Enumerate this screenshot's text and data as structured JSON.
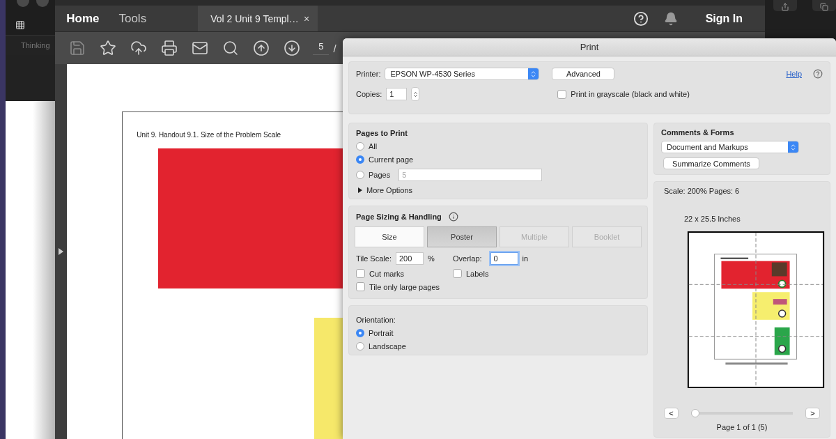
{
  "side_app": {
    "label": "Thinking"
  },
  "nav": [
    {
      "label": "Home",
      "selected": true
    },
    {
      "label": "Tools",
      "selected": false
    }
  ],
  "document_tab": {
    "label": "Vol 2 Unit 9 Templ…",
    "close": "×"
  },
  "sign_in": "Sign In",
  "toolbar": {
    "page": "5",
    "separator": "/"
  },
  "document": {
    "heading": "Unit 9. Handout 9.1. Size of the Problem Scale"
  },
  "print": {
    "title": "Print",
    "printer_label": "Printer:",
    "printer": "EPSON WP-4530 Series",
    "advanced": "Advanced",
    "help": "Help",
    "copies_label": "Copies:",
    "copies": "1",
    "grayscale": {
      "label": "Print in grayscale (black and white)",
      "checked": false
    },
    "pages_to_print": {
      "title": "Pages to Print",
      "options": [
        {
          "label": "All",
          "selected": false
        },
        {
          "label": "Current page",
          "selected": true
        },
        {
          "label": "Pages",
          "selected": false
        }
      ],
      "pages_placeholder": "5",
      "more_options": {
        "label": "More Options",
        "expanded": false
      }
    },
    "sizing": {
      "title": "Page Sizing & Handling",
      "modes": [
        {
          "label": "Size",
          "selected": false,
          "disabled": false
        },
        {
          "label": "Poster",
          "selected": true,
          "disabled": false
        },
        {
          "label": "Multiple",
          "selected": false,
          "disabled": true
        },
        {
          "label": "Booklet",
          "selected": false,
          "disabled": true
        }
      ],
      "tile_scale_label": "Tile Scale:",
      "tile_scale": "200",
      "percent": "%",
      "overlap_label": "Overlap:",
      "overlap": "0",
      "unit": "in",
      "options": [
        {
          "label": "Cut marks",
          "checked": false
        },
        {
          "label": "Labels",
          "checked": false
        },
        {
          "label": "Tile only large pages",
          "checked": false
        }
      ]
    },
    "orientation": {
      "title": "Orientation:",
      "options": [
        {
          "label": "Portrait",
          "selected": true
        },
        {
          "label": "Landscape",
          "selected": false
        }
      ]
    },
    "comments": {
      "title": "Comments & Forms",
      "select": "Document and Markups",
      "summarize": "Summarize Comments"
    },
    "preview": {
      "scale": "Scale: 200% Pages: 6",
      "size": "22 x 25.5 Inches",
      "prev": "<",
      "next": ">",
      "page": "Page 1 of 1 (5)",
      "level": 0
    }
  }
}
